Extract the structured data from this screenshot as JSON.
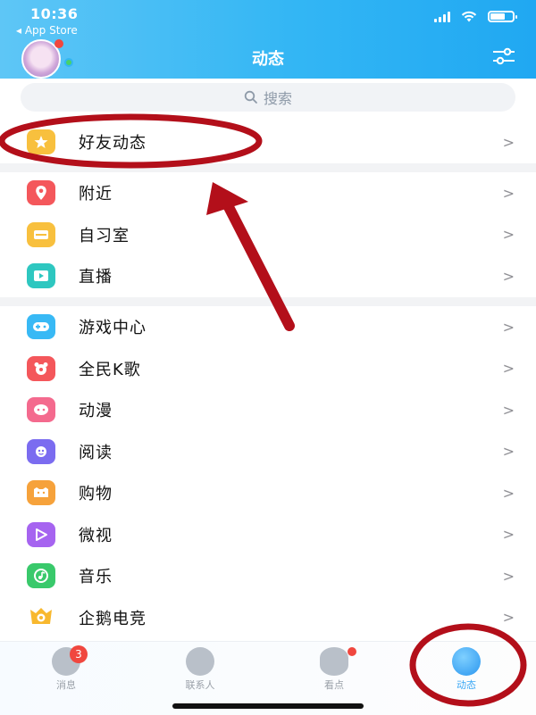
{
  "status_bar": {
    "time": "10:36",
    "back_app": "◂ App Store"
  },
  "header": {
    "title": "动态"
  },
  "search": {
    "placeholder": "搜索"
  },
  "sections": [
    {
      "items": [
        {
          "label": "好友动态",
          "icon": "friends-star-icon",
          "color": "#f8c03e"
        }
      ]
    },
    {
      "items": [
        {
          "label": "附近",
          "icon": "location-pin-icon",
          "color": "#f4575b"
        },
        {
          "label": "自习室",
          "icon": "study-room-icon",
          "color": "#f8c03e"
        },
        {
          "label": "直播",
          "icon": "live-stream-icon",
          "color": "#2ec7c0"
        }
      ]
    },
    {
      "items": [
        {
          "label": "游戏中心",
          "icon": "gamepad-icon",
          "color": "#38b9f5"
        },
        {
          "label": "全民K歌",
          "icon": "karaoke-icon",
          "color": "#f4575b"
        },
        {
          "label": "动漫",
          "icon": "anime-icon",
          "color": "#f46a8e"
        },
        {
          "label": "阅读",
          "icon": "reading-icon",
          "color": "#7b6cf0"
        },
        {
          "label": "购物",
          "icon": "shopping-icon",
          "color": "#f6a23b"
        },
        {
          "label": "微视",
          "icon": "weishi-icon",
          "color": "#a664f0"
        },
        {
          "label": "音乐",
          "icon": "music-icon",
          "color": "#39c96b"
        },
        {
          "label": "企鹅电竞",
          "icon": "esports-icon",
          "color": "#f8b82e"
        }
      ]
    }
  ],
  "chevron": ">",
  "tabbar": [
    {
      "label": "消息",
      "badge": "3",
      "icon": "chat-bubble-icon"
    },
    {
      "label": "联系人",
      "icon": "contacts-icon"
    },
    {
      "label": "看点",
      "icon": "eye-icon"
    },
    {
      "label": "动态",
      "icon": "planet-star-icon",
      "active": true
    }
  ],
  "colors": {
    "header_start": "#5ec6f6",
    "header_end": "#20a8f2",
    "annotation": "#b30f1a",
    "active_tab": "#39a7f5"
  }
}
